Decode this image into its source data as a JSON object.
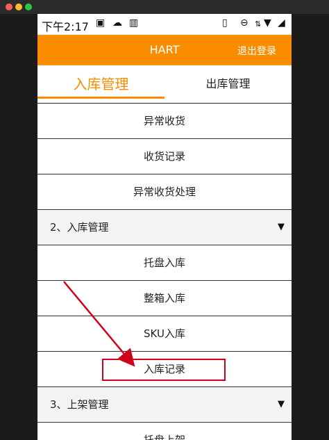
{
  "status_bar": {
    "time": "下午2:17"
  },
  "header": {
    "title": "HART",
    "logout_label": "退出登录"
  },
  "tabs": [
    {
      "label": "入库管理",
      "active": true
    },
    {
      "label": "出库管理",
      "active": false
    }
  ],
  "menu": {
    "group1_items": [
      "异常收货",
      "收货记录",
      "异常收货处理"
    ],
    "section2": {
      "label": "2、入库管理",
      "items": [
        "托盘入库",
        "整箱入库",
        "SKU入库",
        "入库记录"
      ]
    },
    "section3": {
      "label": "3、上架管理",
      "items": [
        "托盘上架"
      ]
    }
  },
  "colors": {
    "accent": "#fb8c00",
    "annotation": "#d0021b"
  }
}
